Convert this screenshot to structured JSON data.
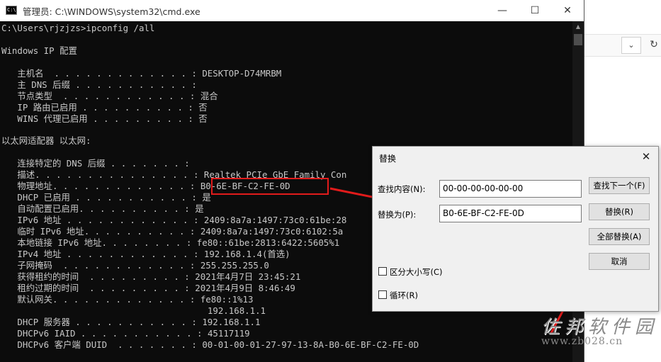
{
  "window": {
    "title": "管理员: C:\\WINDOWS\\system32\\cmd.exe",
    "icon_text": "C:\\",
    "controls": {
      "minimize": "—",
      "maximize": "☐",
      "close": "✕"
    }
  },
  "console": {
    "prompt": "C:\\Users\\rjzjzs>ipconfig /all",
    "header": "Windows IP 配置",
    "host_section": [
      {
        "label": "   主机名  . . . . . . . . . . . . . :",
        "value": " DESKTOP-D74MRBM"
      },
      {
        "label": "   主 DNS 后缀 . . . . . . . . . . . :",
        "value": ""
      },
      {
        "label": "   节点类型  . . . . . . . . . . . . :",
        "value": " 混合"
      },
      {
        "label": "   IP 路由已启用 . . . . . . . . . . :",
        "value": " 否"
      },
      {
        "label": "   WINS 代理已启用 . . . . . . . . . :",
        "value": " 否"
      }
    ],
    "adapter_header": "以太网适配器 以太网:",
    "adapter_section": [
      {
        "label": "   连接特定的 DNS 后缀 . . . . . . . :",
        "value": ""
      },
      {
        "label": "   描述. . . . . . . . . . . . . . . :",
        "value": " Realtek PCIe GbE Family Con"
      },
      {
        "label": "   物理地址. . . . . . . . . . . . . :",
        "value": " B0-6E-BF-C2-FE-0D"
      },
      {
        "label": "   DHCP 已启用 . . . . . . . . . . . :",
        "value": " 是"
      },
      {
        "label": "   自动配置已启用. . . . . . . . . . :",
        "value": " 是"
      },
      {
        "label": "   IPv6 地址 . . . . . . . . . . . . :",
        "value": " 2409:8a7a:1497:73c0:61be:28"
      },
      {
        "label": "   临时 IPv6 地址. . . . . . . . . . :",
        "value": " 2409:8a7a:1497:73c0:6102:5a"
      },
      {
        "label": "   本地链接 IPv6 地址. . . . . . . . :",
        "value": " fe80::61be:2813:6422:5605%1"
      },
      {
        "label": "   IPv4 地址 . . . . . . . . . . . . :",
        "value": " 192.168.1.4(首选)"
      },
      {
        "label": "   子网掩码  . . . . . . . . . . . . :",
        "value": " 255.255.255.0"
      },
      {
        "label": "   获得租约的时间  . . . . . . . . . :",
        "value": " 2021年4月7日 23:45:21"
      },
      {
        "label": "   租约过期的时间  . . . . . . . . . :",
        "value": " 2021年4月9日 8:46:49"
      },
      {
        "label": "   默认网关. . . . . . . . . . . . . :",
        "value": " fe80::1%13"
      },
      {
        "label": "",
        "value": "                                       192.168.1.1"
      },
      {
        "label": "   DHCP 服务器 . . . . . . . . . . . :",
        "value": " 192.168.1.1"
      },
      {
        "label": "   DHCPv6 IAID . . . . . . . . . . . :",
        "value": " 45117119"
      },
      {
        "label": "   DHCPv6 客户端 DUID  . . . . . . . :",
        "value": " 00-01-00-01-27-97-13-8A-B0-6E-BF-C2-FE-0D"
      }
    ]
  },
  "dialog": {
    "title": "替换",
    "close": "✕",
    "find_label": "查找内容(N):",
    "find_value": "00-00-00-00-00-00",
    "replace_label": "替换为(P):",
    "replace_value": "B0-6E-BF-C2-FE-0D",
    "buttons": {
      "find_next": "查找下一个(F)",
      "replace": "替换(R)",
      "replace_all": "全部替换(A)",
      "cancel": "取消"
    },
    "match_case": "区分大小写(C)",
    "wrap": "循环(R)"
  },
  "watermark": {
    "title": "佐邦软件园",
    "url": "www.zb028.cn"
  },
  "colors": {
    "highlight": "#e21b1b",
    "console_bg": "#0c0c0c",
    "console_text": "#c8c8c8"
  }
}
